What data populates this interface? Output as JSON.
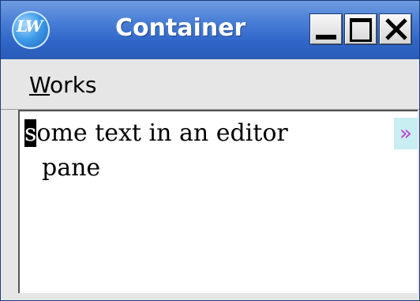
{
  "window": {
    "title": "Container",
    "app_icon_text": "LW",
    "controls": {
      "minimize_icon": "minimize-icon",
      "maximize_icon": "maximize-icon",
      "close_icon": "close-icon"
    }
  },
  "menubar": {
    "items": [
      {
        "mnemonic": "W",
        "rest": "orks"
      }
    ]
  },
  "editor": {
    "lines": [
      {
        "cursor_char": "s",
        "text": "ome text in an editor"
      },
      {
        "text": "pane"
      }
    ],
    "wrap_marker": "»"
  },
  "colors": {
    "titlebar": "#2f66c8",
    "wrap_marker_bg": "#c8eef2",
    "wrap_marker_fg": "#c040d0"
  }
}
